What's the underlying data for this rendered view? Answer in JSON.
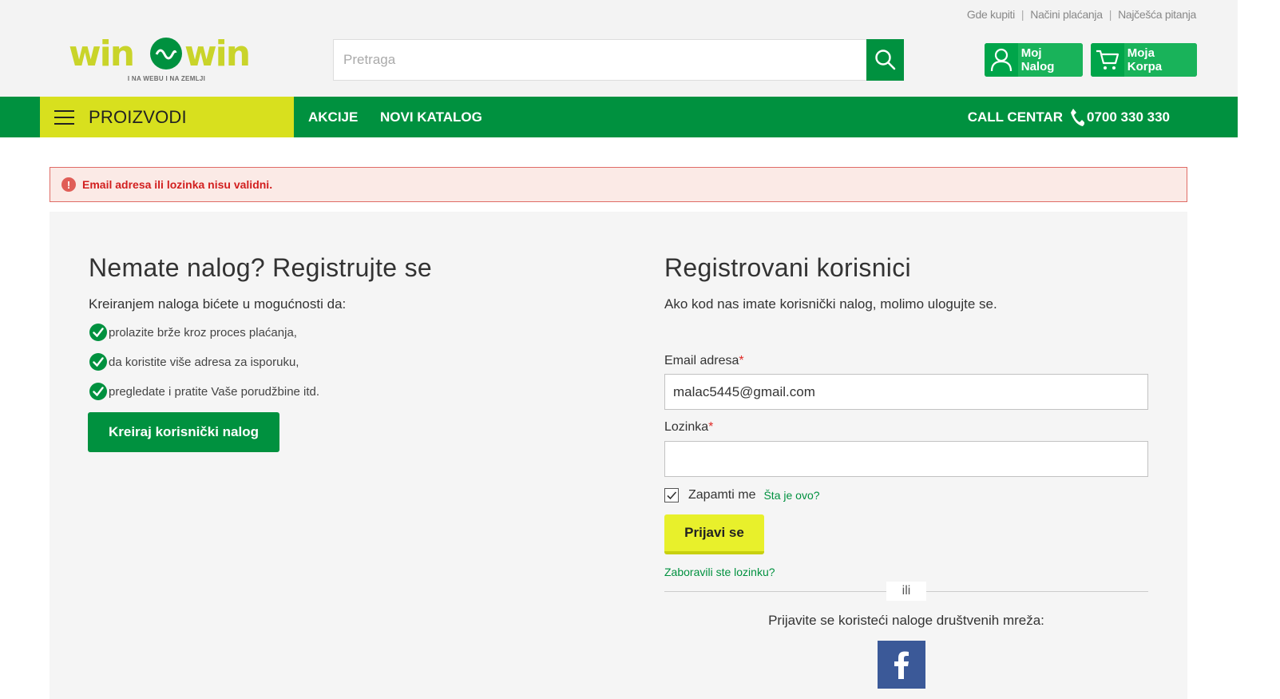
{
  "header": {
    "top_links": [
      "Gde kupiti",
      "Načini plaćanja",
      "Najčešća pitanja"
    ],
    "logo_text": "win win",
    "logo_tagline": "I NA WEBU I NA ZEMLJI",
    "search_placeholder": "Pretraga",
    "account_label": "Moj Nalog",
    "cart_label": "Moja Korpa"
  },
  "nav": {
    "products": "PROIZVODI",
    "links": [
      "AKCIJE",
      "NOVI KATALOG"
    ],
    "call_label": "CALL CENTAR",
    "phone": "0700 330 330"
  },
  "error": {
    "message": "Email adresa ili lozinka nisu validni."
  },
  "register": {
    "title": "Nemate nalog? Registrujte se",
    "intro": "Kreiranjem naloga bićete u mogućnosti da:",
    "benefits": [
      "prolazite brže kroz proces plaćanja,",
      "da koristite više adresa za isporuku,",
      "pregledate i pratite Vaše porudžbine itd."
    ],
    "button": "Kreiraj korisnički nalog"
  },
  "login": {
    "title": "Registrovani korisnici",
    "intro": "Ako kod nas imate korisnički nalog, molimo ulogujte se.",
    "email_label": "Email adresa",
    "email_value": "malac5445@gmail.com",
    "password_label": "Lozinka",
    "password_value": "",
    "required_mark": "*",
    "remember_label": "Zapamti me",
    "remember_checked": true,
    "what_link": "Šta je ovo?",
    "button": "Prijavi se",
    "forgot": "Zaboravili ste lozinku?",
    "or": "ili",
    "social_text": "Prijavite se koristeći naloge društvenih mreža:"
  },
  "colors": {
    "brand_green": "#00913f",
    "brand_lime": "#d8e01e",
    "error_red": "#d21f1f"
  }
}
